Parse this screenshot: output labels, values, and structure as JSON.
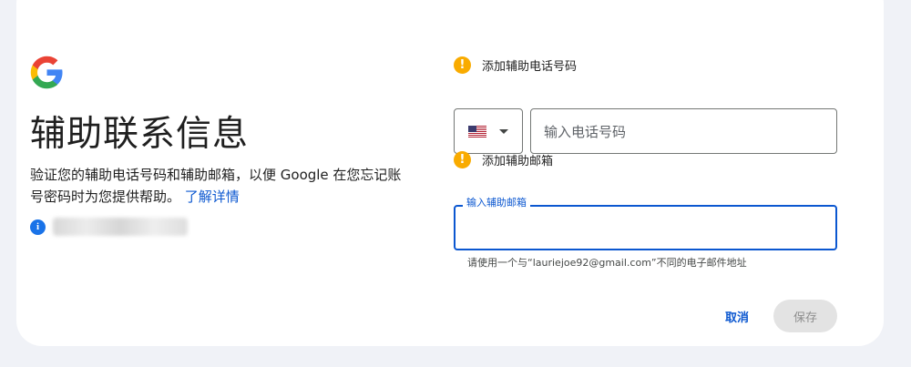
{
  "page": {
    "title": "辅助联系信息",
    "description": "验证您的辅助电话号码和辅助邮箱，以便 Google 在您忘记账号密码时为您提供帮助。",
    "learn_more": "了解详情",
    "account_icon": "i"
  },
  "phone_section": {
    "heading": "添加辅助电话号码",
    "warning_icon": "!",
    "country": "US",
    "placeholder": "输入电话号码"
  },
  "email_section": {
    "heading": "添加辅助邮箱",
    "warning_icon": "!",
    "label": "输入辅助邮箱",
    "value": "",
    "helper": "请使用一个与“lauriejoe92@gmail.com”不同的电子邮件地址"
  },
  "actions": {
    "cancel": "取消",
    "save": "保存"
  },
  "colors": {
    "accent": "#0b57d0",
    "warning": "#f9ab00",
    "info": "#1a73e8",
    "background": "#f0f2f7"
  }
}
